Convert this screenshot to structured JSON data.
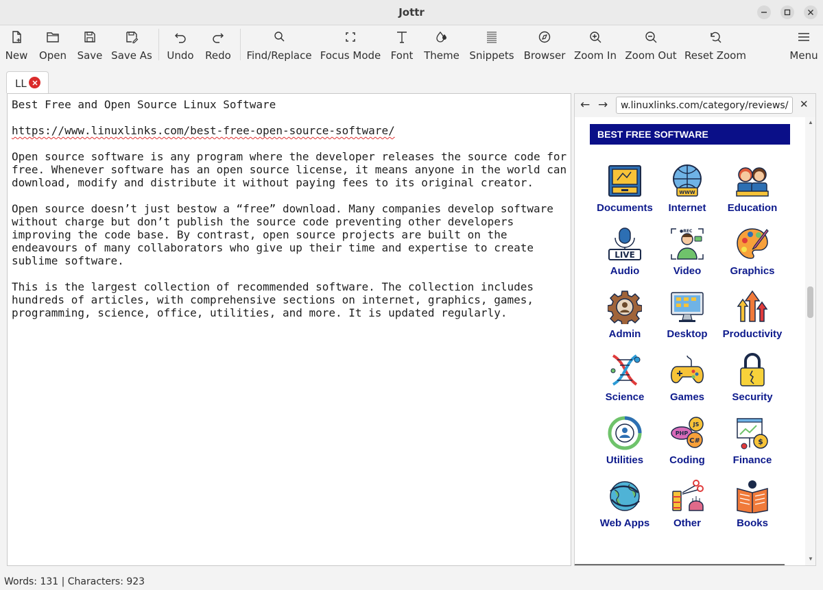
{
  "window": {
    "title": "Jottr"
  },
  "toolbar": {
    "new": "New",
    "open": "Open",
    "save": "Save",
    "save_as": "Save As",
    "undo": "Undo",
    "redo": "Redo",
    "find_replace": "Find/Replace",
    "focus_mode": "Focus Mode",
    "font": "Font",
    "theme": "Theme",
    "snippets": "Snippets",
    "browser": "Browser",
    "zoom_in": "Zoom In",
    "zoom_out": "Zoom Out",
    "reset_zoom": "Reset Zoom",
    "menu": "Menu"
  },
  "tab": {
    "label": "LL"
  },
  "editor": {
    "lines": [
      "Best Free and Open Source Linux Software",
      "",
      "https://www.linuxlinks.com/best-free-open-source-software/",
      "",
      "Open source software is any program where the developer releases the source code for",
      "free. Whenever software has an open source license, it means anyone in the world can",
      "download, modify and distribute it without paying fees to its original creator.",
      "",
      "Open source doesn’t just bestow a “free” download. Many companies develop software",
      "without charge but don’t publish the source code preventing other developers",
      "improving the code base. By contrast, open source projects are built on the",
      "endeavours of many collaborators who give up their time and expertise to create",
      "sublime software.",
      "",
      "This is the largest collection of recommended software. The collection includes",
      "hundreds of articles, with comprehensive sections on internet, graphics, games,",
      "programming, science, office, utilities, and more. It is updated regularly."
    ]
  },
  "browser": {
    "url": "w.linuxlinks.com/category/reviews/",
    "back": "←",
    "forward": "→",
    "close": "✕",
    "banner": "BEST FREE SOFTWARE",
    "categories": [
      {
        "label": "Documents",
        "icon": "documents-icon"
      },
      {
        "label": "Internet",
        "icon": "internet-icon"
      },
      {
        "label": "Education",
        "icon": "education-icon"
      },
      {
        "label": "Audio",
        "icon": "audio-icon"
      },
      {
        "label": "Video",
        "icon": "video-icon"
      },
      {
        "label": "Graphics",
        "icon": "graphics-icon"
      },
      {
        "label": "Admin",
        "icon": "admin-icon"
      },
      {
        "label": "Desktop",
        "icon": "desktop-icon"
      },
      {
        "label": "Productivity",
        "icon": "productivity-icon"
      },
      {
        "label": "Science",
        "icon": "science-icon"
      },
      {
        "label": "Games",
        "icon": "games-icon"
      },
      {
        "label": "Security",
        "icon": "security-icon"
      },
      {
        "label": "Utilities",
        "icon": "utilities-icon"
      },
      {
        "label": "Coding",
        "icon": "coding-icon"
      },
      {
        "label": "Finance",
        "icon": "finance-icon"
      },
      {
        "label": "Web Apps",
        "icon": "web-apps-icon"
      },
      {
        "label": "Other",
        "icon": "other-icon"
      },
      {
        "label": "Books",
        "icon": "books-icon"
      }
    ]
  },
  "status": {
    "text": "Words: 131 | Characters: 923"
  },
  "colors": {
    "banner": "#0a0f88",
    "category_text": "#0d1a8c",
    "tab_close": "#da2b2b"
  }
}
